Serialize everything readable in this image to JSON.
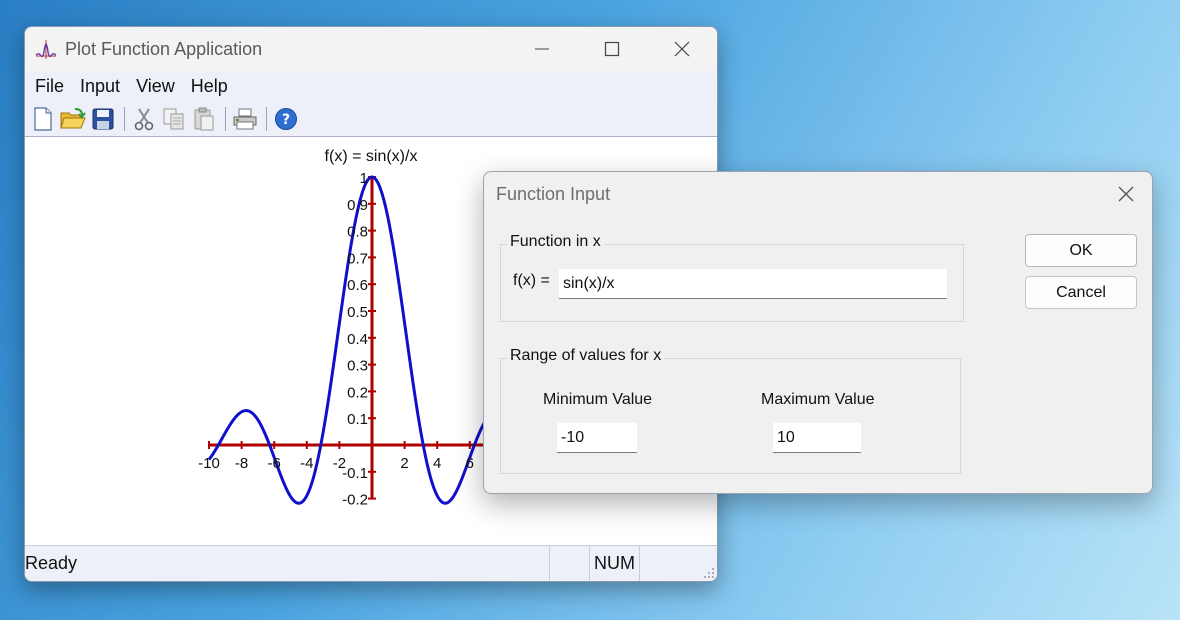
{
  "main_window": {
    "title": "Plot Function Application",
    "menu": [
      "File",
      "Input",
      "View",
      "Help"
    ],
    "toolbar_icons": [
      "new-file-icon",
      "open-folder-icon",
      "save-icon",
      "cut-icon",
      "copy-icon",
      "paste-icon",
      "print-icon",
      "help-icon"
    ],
    "status": {
      "ready": "Ready",
      "num": "NUM"
    }
  },
  "plot": {
    "title": "f(x) = sin(x)/x",
    "x_ticks": [
      "-10",
      "-8",
      "-6",
      "-4",
      "-2",
      "2",
      "4",
      "6"
    ],
    "y_ticks": [
      "1",
      "0.9",
      "0.8",
      "0.7",
      "0.6",
      "0.5",
      "0.4",
      "0.3",
      "0.2",
      "0.1",
      "-0.1",
      "-0.2"
    ],
    "curve_color": "#1010cc",
    "axis_color": "#b00000"
  },
  "chart_data": {
    "type": "line",
    "title": "f(x) = sin(x)/x",
    "xlim": [
      -10,
      10
    ],
    "ylim": [
      -0.2,
      1
    ],
    "series": [
      {
        "function": "sin(x)/x"
      }
    ]
  },
  "dialog": {
    "title": "Function Input",
    "function_group_label": "Function in x",
    "fx_label": "f(x) =",
    "fx_value": "sin(x)/x",
    "range_group_label": "Range of values for x",
    "min_label": "Minimum Value",
    "min_value": "-10",
    "max_label": "Maximum Value",
    "max_value": "10",
    "ok_label": "OK",
    "cancel_label": "Cancel"
  }
}
